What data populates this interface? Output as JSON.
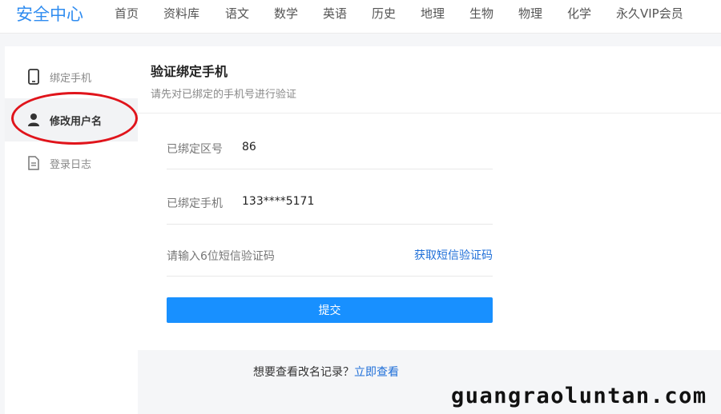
{
  "header": {
    "brand": "安全中心",
    "nav": [
      "首页",
      "资料库",
      "语文",
      "数学",
      "英语",
      "历史",
      "地理",
      "生物",
      "物理",
      "化学",
      "永久VIP会员"
    ]
  },
  "sidebar": {
    "items": [
      {
        "label": "绑定手机",
        "icon": "phone-icon",
        "active": false
      },
      {
        "label": "修改用户名",
        "icon": "user-icon",
        "active": true
      },
      {
        "label": "登录日志",
        "icon": "document-icon",
        "active": false
      }
    ]
  },
  "main": {
    "title": "验证绑定手机",
    "subtitle": "请先对已绑定的手机号进行验证",
    "fields": [
      {
        "label": "已绑定区号",
        "value": "86"
      },
      {
        "label": "已绑定手机",
        "value": "133****5171"
      }
    ],
    "sms": {
      "label": "请输入6位短信验证码",
      "link": "获取短信验证码"
    },
    "submit": "提交"
  },
  "footer": {
    "question": "想要查看改名记录？",
    "link": "立即查看"
  },
  "watermark": "guangraoluntan.com",
  "colors": {
    "brand": "#2f8cf0",
    "primary": "#1890ff",
    "link": "#1f6fd8",
    "highlight": "#e0141b"
  }
}
